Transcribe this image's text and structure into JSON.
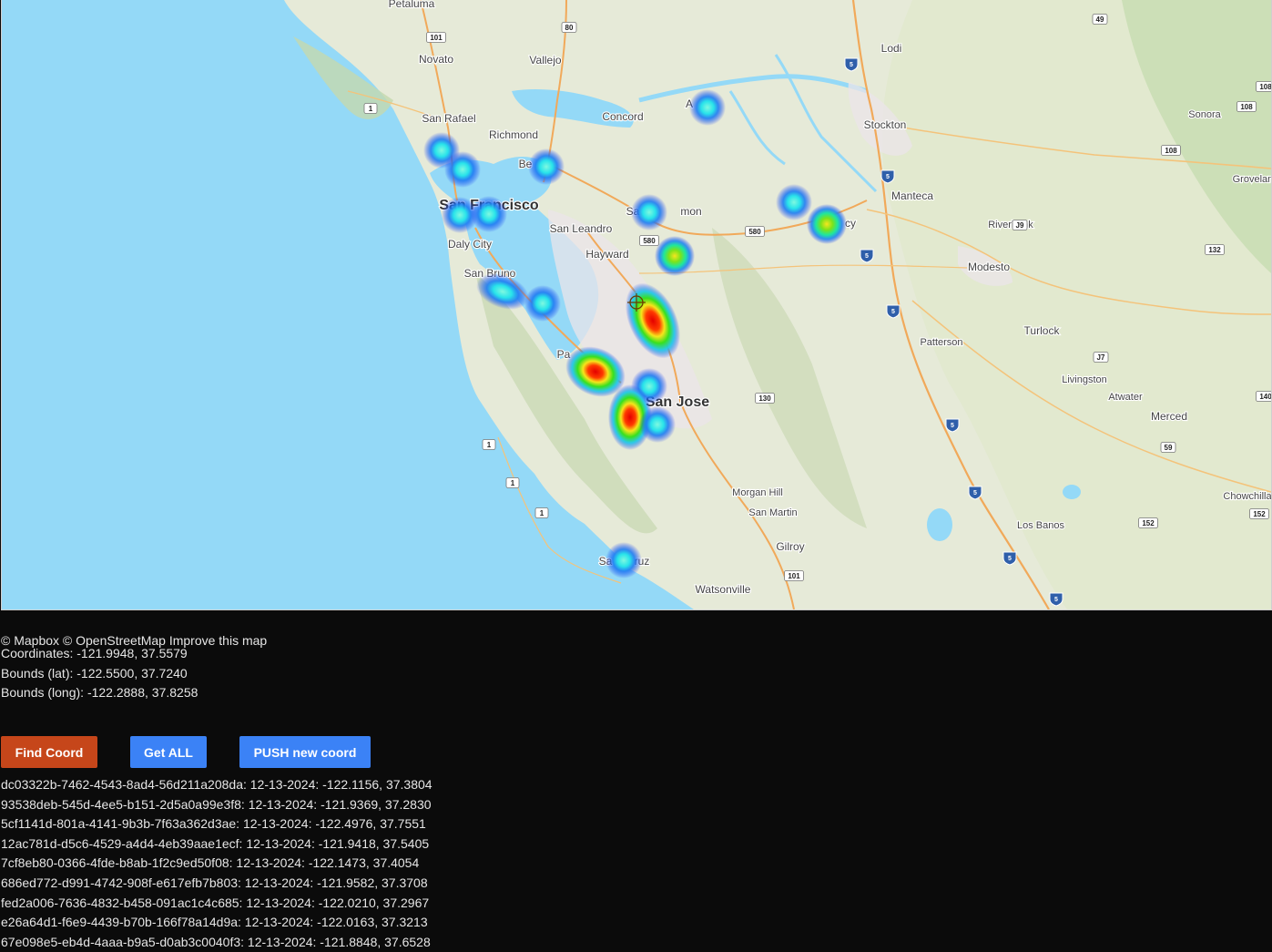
{
  "map": {
    "places": [
      {
        "name": "Petaluma",
        "size": "med"
      },
      {
        "name": "Novato",
        "size": "med"
      },
      {
        "name": "Vallejo",
        "size": "med"
      },
      {
        "name": "San Rafael",
        "size": "med"
      },
      {
        "name": "Richmond",
        "size": "med"
      },
      {
        "name": "Concord",
        "size": "med"
      },
      {
        "name": "Be",
        "size": "med"
      },
      {
        "name": "A",
        "size": "med"
      },
      {
        "name": "San Francisco",
        "size": "big"
      },
      {
        "name": "Daly City",
        "size": "med"
      },
      {
        "name": "San Leandro",
        "size": "med"
      },
      {
        "name": "Hayward",
        "size": "med"
      },
      {
        "name": "San Bruno",
        "size": "med"
      },
      {
        "name": "Sa",
        "size": "med"
      },
      {
        "name": "mon",
        "size": "med"
      },
      {
        "name": "San Jose",
        "size": "big"
      },
      {
        "name": "Pa",
        "size": "med"
      },
      {
        "name": "Lodi",
        "size": "med"
      },
      {
        "name": "Stockton",
        "size": "med"
      },
      {
        "name": "Manteca",
        "size": "med"
      },
      {
        "name": "cy",
        "size": "med"
      },
      {
        "name": "Riverbank",
        "size": "sm"
      },
      {
        "name": "Modesto",
        "size": "med"
      },
      {
        "name": "Sonora",
        "size": "sm"
      },
      {
        "name": "Groveland",
        "size": "sm"
      },
      {
        "name": "Turlock",
        "size": "med"
      },
      {
        "name": "Patterson",
        "size": "sm"
      },
      {
        "name": "Livingston",
        "size": "sm"
      },
      {
        "name": "Atwater",
        "size": "sm"
      },
      {
        "name": "Merced",
        "size": "med"
      },
      {
        "name": "Morgan Hill",
        "size": "sm"
      },
      {
        "name": "San Martin",
        "size": "sm"
      },
      {
        "name": "Gilroy",
        "size": "med"
      },
      {
        "name": "Chowchilla",
        "size": "sm"
      },
      {
        "name": "Los Banos",
        "size": "sm"
      },
      {
        "name": "Sa",
        "size": "med"
      },
      {
        "name": "ruz",
        "size": "med"
      },
      {
        "name": "Watsonville",
        "size": "med"
      }
    ],
    "shields": [
      "101",
      "80",
      "49",
      "1",
      "108",
      "108",
      "108",
      "580",
      "580",
      "J9",
      "132",
      "J7",
      "130",
      "140",
      "59",
      "1",
      "1",
      "1",
      "152",
      "152",
      "101"
    ],
    "interstates": [
      "5",
      "5",
      "5",
      "5",
      "5",
      "5",
      "5",
      "5"
    ]
  },
  "attribution": "© Mapbox © OpenStreetMap Improve this map",
  "info": {
    "coordinates": "Coordinates: -121.9948, 37.5579",
    "bounds_lat": "Bounds (lat): -122.5500, 37.7240",
    "bounds_long": "Bounds (long): -122.2888, 37.8258"
  },
  "buttons": {
    "find": "Find Coord",
    "get_all": "Get ALL",
    "push": "PUSH new coord"
  },
  "coords": [
    "dc03322b-7462-4543-8ad4-56d211a208da: 12-13-2024: -122.1156, 37.3804",
    "93538deb-545d-4ee5-b151-2d5a0a99e3f8: 12-13-2024: -121.9369, 37.2830",
    "5cf1141d-801a-4141-9b3b-7f63a362d3ae: 12-13-2024: -122.4976, 37.7551",
    "12ac781d-d5c6-4529-a4d4-4eb39aae1ecf: 12-13-2024: -121.9418, 37.5405",
    "7cf8eb80-0366-4fde-b8ab-1f2c9ed50f08: 12-13-2024: -122.1473, 37.4054",
    "686ed772-d991-4742-908f-e617efb7b803: 12-13-2024: -121.9582, 37.3708",
    "fed2a006-7636-4832-b458-091ac1c4c685: 12-13-2024: -122.0210, 37.2967",
    "e26a64d1-f6e9-4439-b70b-166f78a14d9a: 12-13-2024: -122.0163, 37.3213",
    "67e098e5-eb4d-4aaa-b9a5-d0ab3c0040f3: 12-13-2024: -121.8848, 37.6528"
  ]
}
